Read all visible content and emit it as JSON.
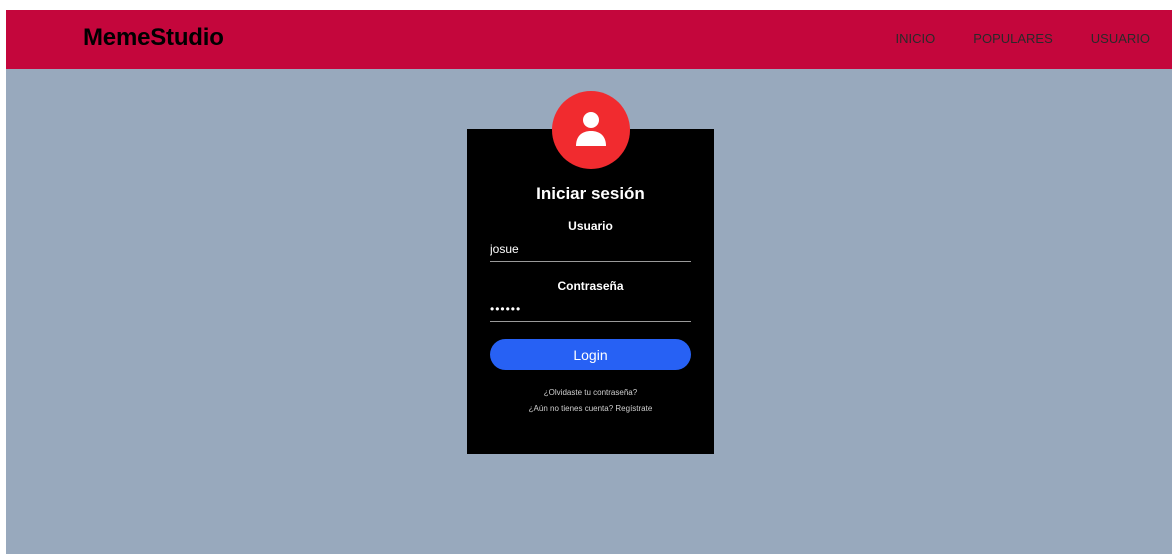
{
  "navbar": {
    "brand": "MemeStudio",
    "links": [
      "INICIO",
      "POPULARES",
      "USUARIO"
    ]
  },
  "login": {
    "title": "Iniciar sesión",
    "username_label": "Usuario",
    "username_value": "josue",
    "password_label": "Contraseña",
    "password_value": "josue1",
    "button_label": "Login",
    "forgot_link": "¿Olvidaste tu contraseña?",
    "register_link": "¿Aún no tienes cuenta? Regístrate"
  },
  "colors": {
    "navbar": "#c4063c",
    "background": "#98a9bd",
    "card": "#000000",
    "avatar": "#f12b2f",
    "button": "#2761f4"
  },
  "icons": {
    "avatar": "user-icon"
  }
}
